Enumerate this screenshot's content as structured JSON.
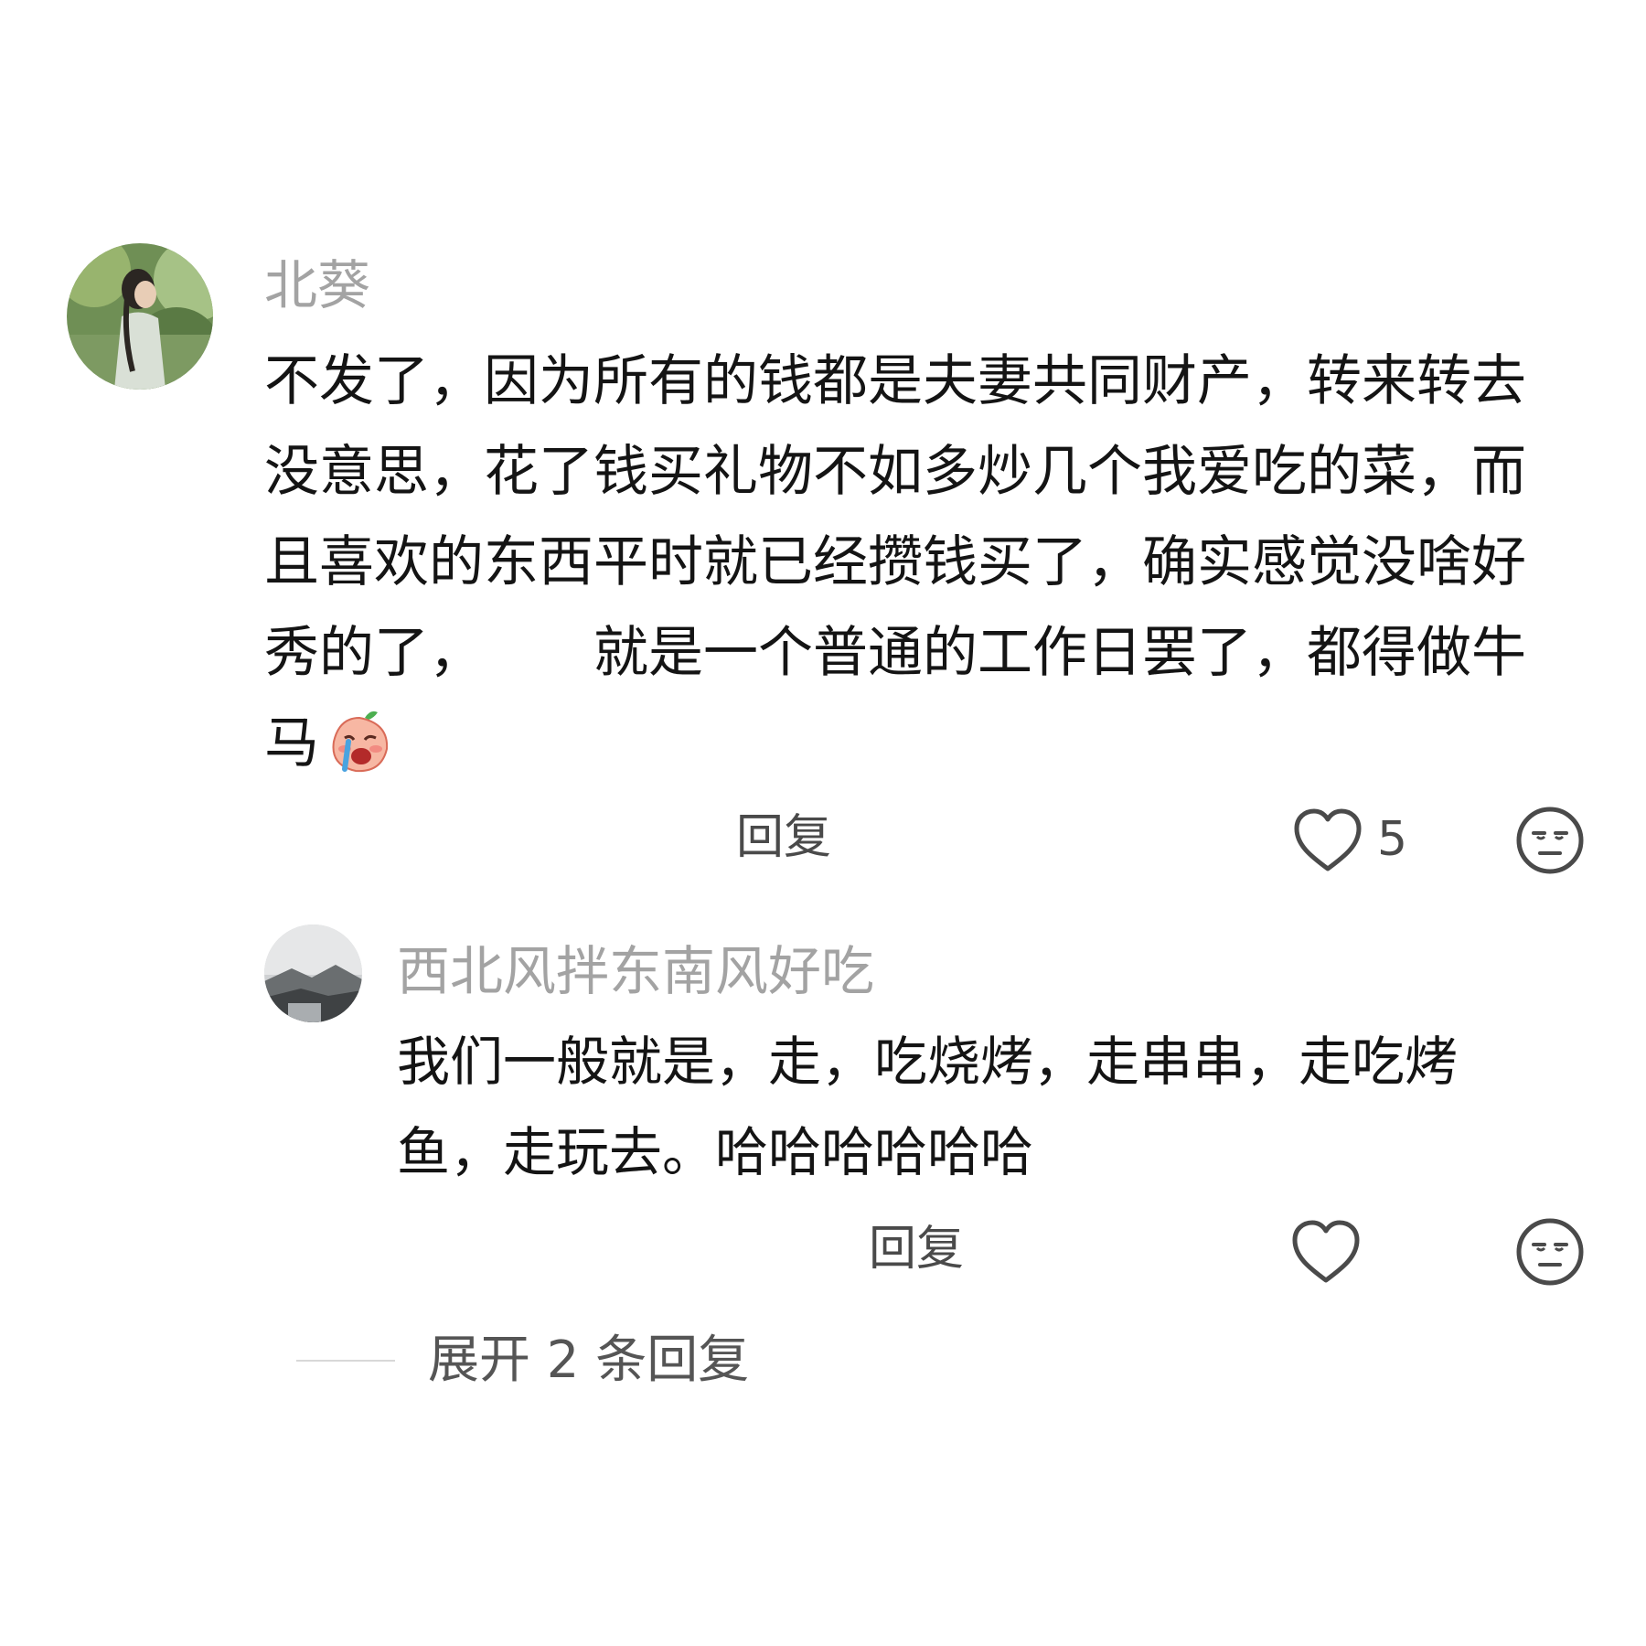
{
  "comment": {
    "username": "北葵",
    "text_lines": [
      "不发了，因为所有的钱都是夫妻共同财产，转来转去",
      "没意思，花了钱买礼物不如多炒几个我爱吃的菜，而",
      "且喜欢的东西平时就已经攒钱买了，确实感觉没啥好"
    ],
    "line4_part1": "秀的了，",
    "line4_part2": "就是一个普通的工作日罢了，都得做牛",
    "line5": "马",
    "emoji_icon": "crying-peach-emoji",
    "reply_label": "回复",
    "like_count": "5",
    "like_icon": "heart-outline-icon",
    "dislike_icon": "unamused-face-icon"
  },
  "reply": {
    "username": "西北风拌东南风好吃",
    "text_lines": [
      "我们一般就是，走，吃烧烤，走串串，走吃烤",
      "鱼，走玩去。哈哈哈哈哈哈"
    ],
    "reply_label": "回复",
    "like_icon": "heart-outline-icon",
    "dislike_icon": "unamused-face-icon"
  },
  "expand": {
    "label": "展开 2 条回复"
  },
  "colors": {
    "username": "#a3a3a3",
    "text": "#141414",
    "action": "#4a4a4a",
    "background": "#ffffff"
  }
}
